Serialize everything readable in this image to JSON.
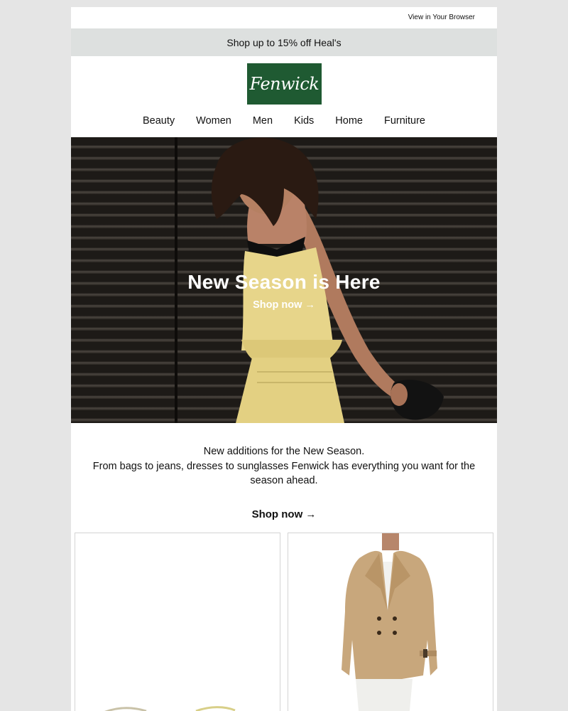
{
  "header": {
    "view_in_browser": "View in Your Browser"
  },
  "promo": {
    "text": "Shop up to 15% off Heal's"
  },
  "brand": {
    "logo_text": "Fenwick",
    "logo_bg": "#1f5a32"
  },
  "nav": {
    "items": [
      "Beauty",
      "Women",
      "Men",
      "Kids",
      "Home",
      "Furniture"
    ]
  },
  "hero": {
    "title": "New Season is Here",
    "cta": "Shop now →"
  },
  "intro": {
    "line1": "New additions for the New Season.",
    "line2": "From bags to jeans, dresses to sunglasses Fenwick has everything you want for the season ahead."
  },
  "cta": {
    "label": "Shop now →"
  },
  "products": [
    {
      "image": "sunglasses-product-image"
    },
    {
      "image": "trench-jacket-product-image"
    }
  ]
}
